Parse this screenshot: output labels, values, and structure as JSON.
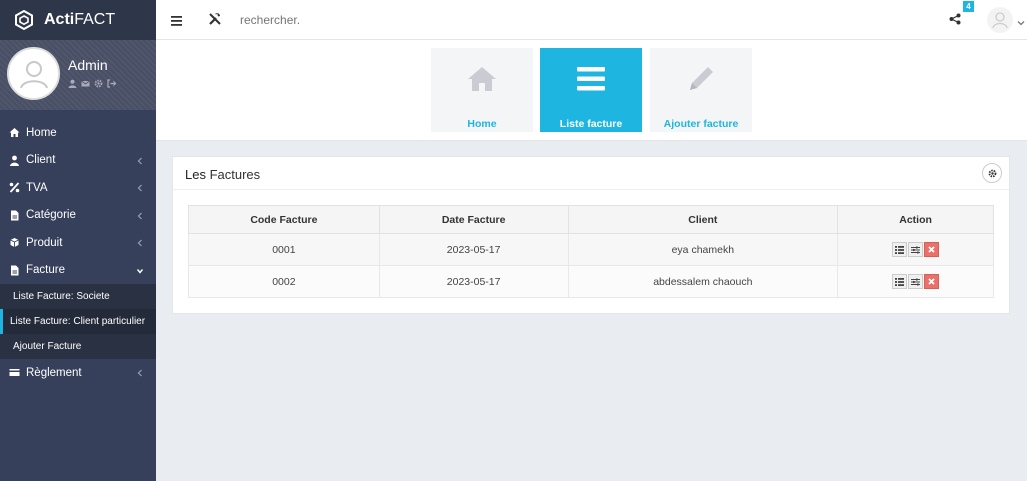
{
  "brand": {
    "bold": "Acti",
    "rest": "FACT"
  },
  "user": {
    "name": "Admin"
  },
  "sidebar": {
    "items": [
      {
        "label": "Home",
        "icon": "home-icon"
      },
      {
        "label": "Client",
        "icon": "user-icon"
      },
      {
        "label": "TVA",
        "icon": "percent-icon"
      },
      {
        "label": "Catégorie",
        "icon": "file-icon"
      },
      {
        "label": "Produit",
        "icon": "cubes-icon"
      },
      {
        "label": "Facture",
        "icon": "file-icon"
      },
      {
        "label": "Règlement",
        "icon": "credit-card-icon"
      }
    ],
    "submenu": [
      {
        "label": "Liste Facture: Societe"
      },
      {
        "label": "Liste Facture: Client particulier"
      },
      {
        "label": "Ajouter Facture"
      }
    ]
  },
  "topbar": {
    "search_placeholder": "rechercher.",
    "badge": "4"
  },
  "tiles": [
    {
      "label": "Home"
    },
    {
      "label": "Liste facture"
    },
    {
      "label": "Ajouter facture"
    }
  ],
  "card": {
    "title_a": "Les",
    "title_b": "Factures"
  },
  "table": {
    "headers": [
      "Code Facture",
      "Date Facture",
      "Client",
      "Action"
    ],
    "rows": [
      {
        "code": "0001",
        "date": "2023-05-17",
        "client": "eya chamekh"
      },
      {
        "code": "0002",
        "date": "2023-05-17",
        "client": "abdessalem chaouch"
      }
    ]
  },
  "colors": {
    "accent": "#1eb6e0",
    "sidebar": "#37405a",
    "delete": "#e8726b"
  }
}
